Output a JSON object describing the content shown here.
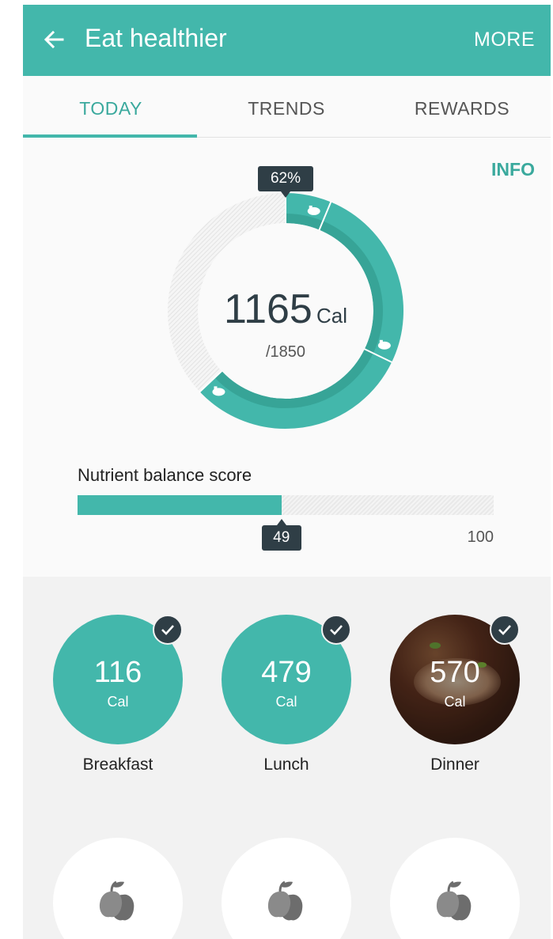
{
  "header": {
    "title": "Eat healthier",
    "more_label": "MORE",
    "back_icon": "back-arrow-icon",
    "bg_color": "#43b7ab"
  },
  "tabs": [
    {
      "label": "TODAY",
      "active": true
    },
    {
      "label": "TRENDS",
      "active": false
    },
    {
      "label": "REWARDS",
      "active": false
    }
  ],
  "summary": {
    "info_label": "INFO",
    "percent_label": "62%",
    "calories": "1165",
    "calories_unit": "Cal",
    "goal": "/1850",
    "ring_segments": [
      {
        "meal": "Breakfast",
        "value": 116,
        "icon": "breakfast-icon"
      },
      {
        "meal": "Lunch",
        "value": 479,
        "icon": "lunch-icon"
      },
      {
        "meal": "Dinner",
        "value": 570,
        "icon": "dinner-icon"
      }
    ],
    "ring_total": 1850,
    "accent_color": "#43b7ab",
    "dark_color": "#2f3e46"
  },
  "nutrient": {
    "label": "Nutrient balance score",
    "score": "49",
    "score_value": 49,
    "max": "100",
    "max_value": 100
  },
  "meals": [
    {
      "name": "Breakfast",
      "cal": "116",
      "unit": "Cal",
      "checked": true,
      "photo": false
    },
    {
      "name": "Lunch",
      "cal": "479",
      "unit": "Cal",
      "checked": true,
      "photo": false
    },
    {
      "name": "Dinner",
      "cal": "570",
      "unit": "Cal",
      "checked": true,
      "photo": true
    }
  ],
  "snacks": [
    {
      "icon": "fruit-icon"
    },
    {
      "icon": "fruit-icon"
    },
    {
      "icon": "fruit-icon"
    }
  ]
}
